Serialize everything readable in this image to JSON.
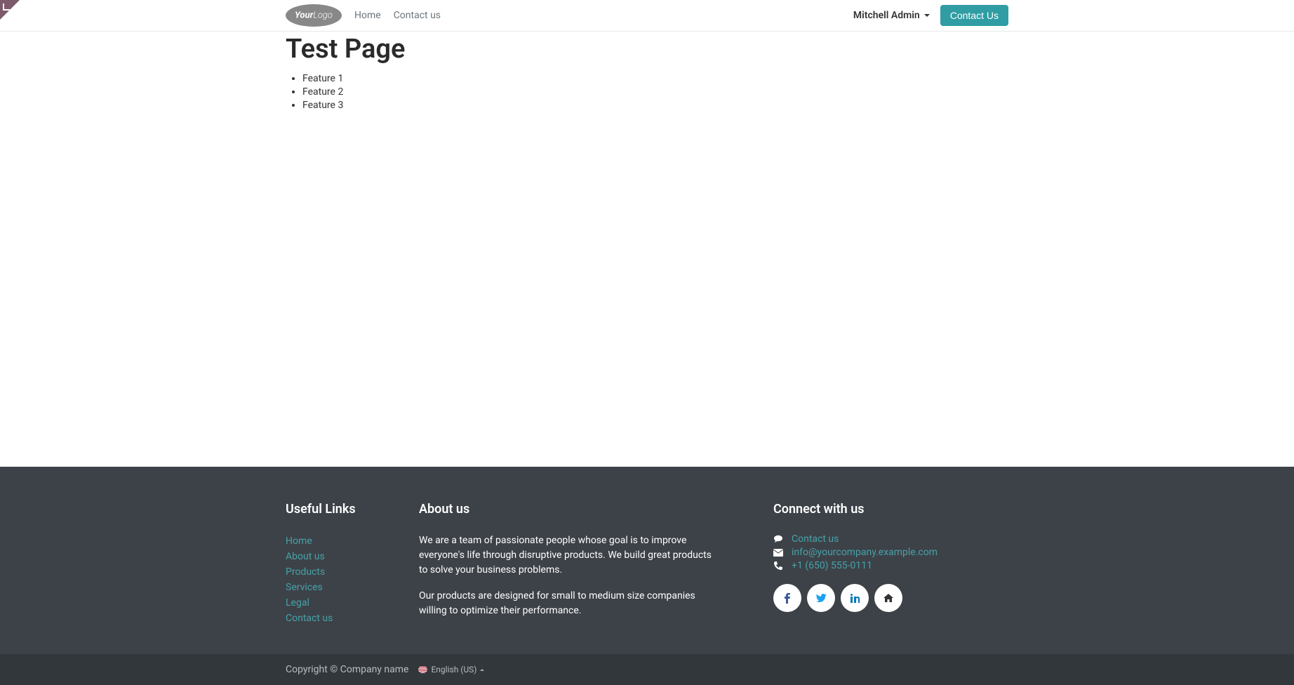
{
  "header": {
    "logo": {
      "text_bold": "Your",
      "text_thin": "Logo"
    },
    "nav": [
      {
        "label": "Home",
        "name": "nav-link-home"
      },
      {
        "label": "Contact us",
        "name": "nav-link-contact"
      }
    ],
    "user": "Mitchell Admin",
    "cta": "Contact Us"
  },
  "main": {
    "title": "Test Page",
    "features": [
      "Feature 1",
      "Feature 2",
      "Feature 3"
    ]
  },
  "footer": {
    "useful_links": {
      "title": "Useful Links",
      "items": [
        {
          "label": "Home"
        },
        {
          "label": "About us"
        },
        {
          "label": "Products"
        },
        {
          "label": "Services"
        },
        {
          "label": "Legal"
        },
        {
          "label": "Contact us"
        }
      ]
    },
    "about": {
      "title": "About us",
      "p1": "We are a team of passionate people whose goal is to improve everyone's life through disruptive products. We build great products to solve your business problems.",
      "p2": "Our products are designed for small to medium size companies willing to optimize their performance."
    },
    "connect": {
      "title": "Connect with us",
      "contact_label": "Contact us",
      "email": "info@yourcompany.example.com",
      "phone": "+1 (650) 555-0111",
      "social": [
        "facebook",
        "twitter",
        "linkedin",
        "home"
      ]
    },
    "copyright": "Copyright © Company name",
    "language": "English (US)"
  }
}
